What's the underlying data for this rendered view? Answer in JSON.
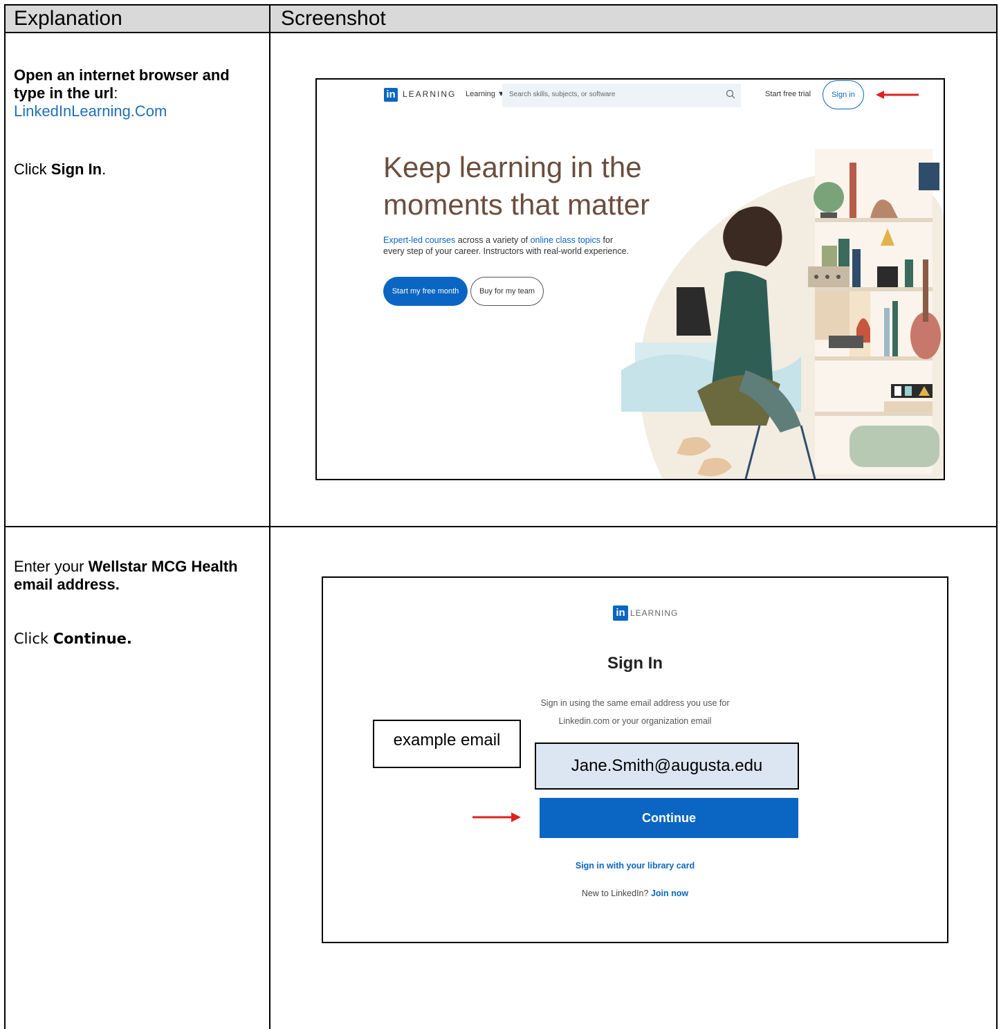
{
  "header": {
    "col1": "Explanation",
    "col2": "Screenshot"
  },
  "row1": {
    "bold_lead": "Open an internet browser and type in the url",
    "colon": ":",
    "url": "LinkedInLearning.Com",
    "click_prefix": "Click ",
    "click_target": "Sign In",
    "click_suffix": ".",
    "shot": {
      "logo": "in",
      "brand": "LEARNING",
      "learning_menu": "Learning ▼",
      "search_placeholder": "Search skills, subjects, or software",
      "start_trial": "Start free trial",
      "sign_in": "Sign in",
      "headline1": "Keep learning in the",
      "headline2": "moments that matter",
      "sub_link1": "Expert-led courses",
      "sub_mid": " across a variety of ",
      "sub_link2": "online class topics",
      "sub_end1": " for",
      "sub_line2": "every step of your career. Instructors with real-world experience.",
      "btn_primary": "Start my free month",
      "btn_secondary": "Buy for my team"
    }
  },
  "row2": {
    "enter_prefix": "Enter your ",
    "enter_bold": "Wellstar MCG Health email address.",
    "click_prefix": "Click ",
    "click_target": "Continue.",
    "shot": {
      "logo": "in",
      "brand": "LEARNING",
      "title": "Sign In",
      "desc1": "Sign in using the same email address you use for",
      "desc2": "Linkedin.com or your organization email",
      "example_label": "example email",
      "email_value": "Jane.Smith@augusta.edu",
      "continue": "Continue",
      "library": "Sign in with your library card",
      "new_prefix": "New to LinkedIn? ",
      "join": "Join now"
    }
  },
  "colors": {
    "linkedin_blue": "#0a66c2",
    "link_blue": "#1f6fb8",
    "arrow_red": "#e0201f",
    "header_gray": "#d9d9d9",
    "email_field": "#dce6f2"
  }
}
